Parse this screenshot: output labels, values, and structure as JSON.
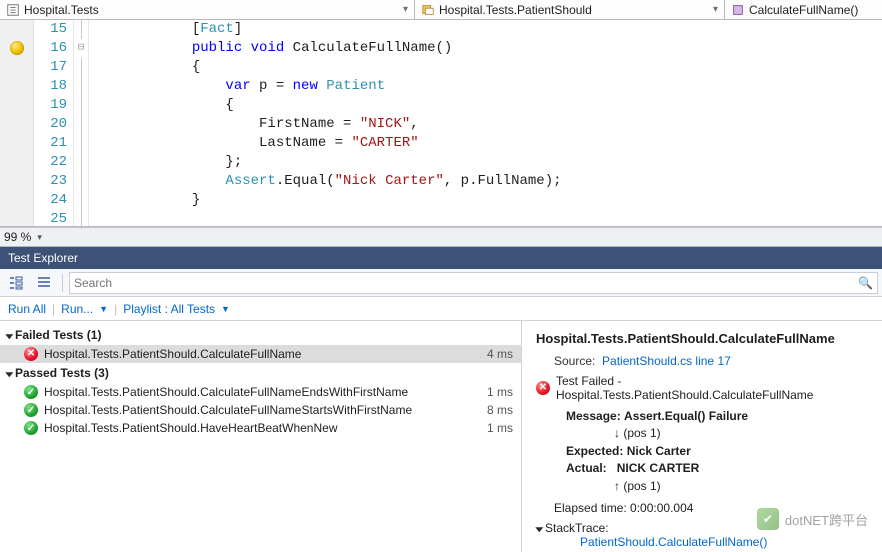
{
  "nav": {
    "namespace": "Hospital.Tests",
    "class": "Hospital.Tests.PatientShould",
    "method": "CalculateFullName()"
  },
  "editor": {
    "lines": [
      {
        "n": 15,
        "html": "            [<span class='tk-attr'>Fact</span>]"
      },
      {
        "n": 16,
        "html": "            <span class='tk-key'>public</span> <span class='tk-key'>void</span> CalculateFullName()"
      },
      {
        "n": 17,
        "html": "            {"
      },
      {
        "n": 18,
        "html": "                <span class='tk-key'>var</span> p = <span class='tk-key'>new</span> <span class='tk-type'>Patient</span>"
      },
      {
        "n": 19,
        "html": "                {"
      },
      {
        "n": 20,
        "html": "                    FirstName = <span class='tk-str'>\"NICK\"</span>,"
      },
      {
        "n": 21,
        "html": "                    LastName = <span class='tk-str'>\"CARTER\"</span>"
      },
      {
        "n": 22,
        "html": "                };"
      },
      {
        "n": 23,
        "html": "                <span class='tk-type'>Assert</span>.Equal(<span class='tk-str'>\"Nick Carter\"</span>, p.FullName);"
      },
      {
        "n": 24,
        "html": "            }"
      },
      {
        "n": 25,
        "html": ""
      }
    ],
    "breakpoint_line": 16
  },
  "zoom": {
    "level": "99 %"
  },
  "test_explorer": {
    "title": "Test Explorer",
    "search_placeholder": "Search",
    "links": {
      "run_all": "Run All",
      "run": "Run...",
      "playlist": "Playlist : All Tests"
    },
    "groups": [
      {
        "label": "Failed Tests (1)",
        "kind": "failed",
        "tests": [
          {
            "name": "Hospital.Tests.PatientShould.CalculateFullName",
            "duration": "4 ms",
            "status": "fail",
            "selected": true
          }
        ]
      },
      {
        "label": "Passed Tests (3)",
        "kind": "passed",
        "tests": [
          {
            "name": "Hospital.Tests.PatientShould.CalculateFullNameEndsWithFirstName",
            "duration": "1 ms",
            "status": "pass"
          },
          {
            "name": "Hospital.Tests.PatientShould.CalculateFullNameStartsWithFirstName",
            "duration": "8 ms",
            "status": "pass"
          },
          {
            "name": "Hospital.Tests.PatientShould.HaveHeartBeatWhenNew",
            "duration": "1 ms",
            "status": "pass"
          }
        ]
      }
    ],
    "detail": {
      "title": "Hospital.Tests.PatientShould.CalculateFullName",
      "source_label": "Source:",
      "source_link": "PatientShould.cs line 17",
      "fail_line": "Test Failed - Hospital.Tests.PatientShould.CalculateFullName",
      "message_label": "Message:",
      "message_value": "Assert.Equal() Failure",
      "pos_down": "↓ (pos 1)",
      "expected_label": "Expected:",
      "expected_value": "Nick Carter",
      "actual_label": "Actual:",
      "actual_value": "NICK CARTER",
      "pos_up": "↑ (pos 1)",
      "elapsed": "Elapsed time: 0:00:00.004",
      "stack_label": "StackTrace:",
      "stack_link": "PatientShould.CalculateFullName()"
    }
  },
  "watermark": "dotNET跨平台"
}
